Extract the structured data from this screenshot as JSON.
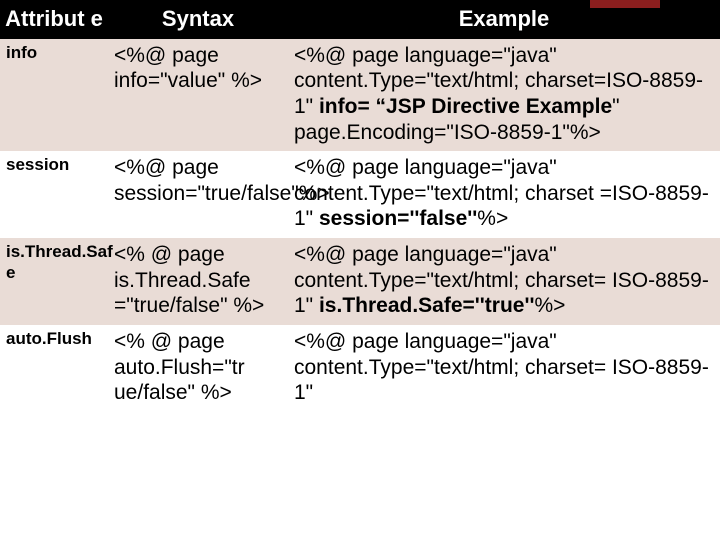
{
  "headers": {
    "attribute": "Attribut e",
    "syntax": "Syntax",
    "example": "Example"
  },
  "rows": [
    {
      "attr": "info",
      "syntax": "<%@ page info=\"value\" %>",
      "ex_a": "<%@ page language=\"java\" content.Type=\"text/html; charset=ISO-8859-1\" ",
      "ex_b": "info= “JSP Directive Example",
      "ex_c": "\" page.Encoding=\"ISO-8859-1\"%>"
    },
    {
      "attr": "session",
      "syntax": "<%@ page session=\"true/false\"%>",
      "ex_a": "<%@ page language=\"java\" content.Type=\"text/html; charset =ISO-8859-1\" ",
      "ex_b": "session=''false''",
      "ex_c": "%>"
    },
    {
      "attr": "is.Thread.Saf e",
      "syntax": "<% @ page is.Thread.Safe =\"true/false\" %>",
      "ex_a": "<%@ page language=\"java\" content.Type=\"text/html; charset= ISO-8859-1\" ",
      "ex_b": "is.Thread.Safe=''true''",
      "ex_c": "%>"
    },
    {
      "attr": "auto.Flush",
      "syntax": "<% @ page auto.Flush=\"tr ue/false\" %>",
      "ex_a": "<%@ page language=\"java\" content.Type=\"text/html; charset= ISO-8859-1\"",
      "ex_b": "",
      "ex_c": ""
    }
  ]
}
